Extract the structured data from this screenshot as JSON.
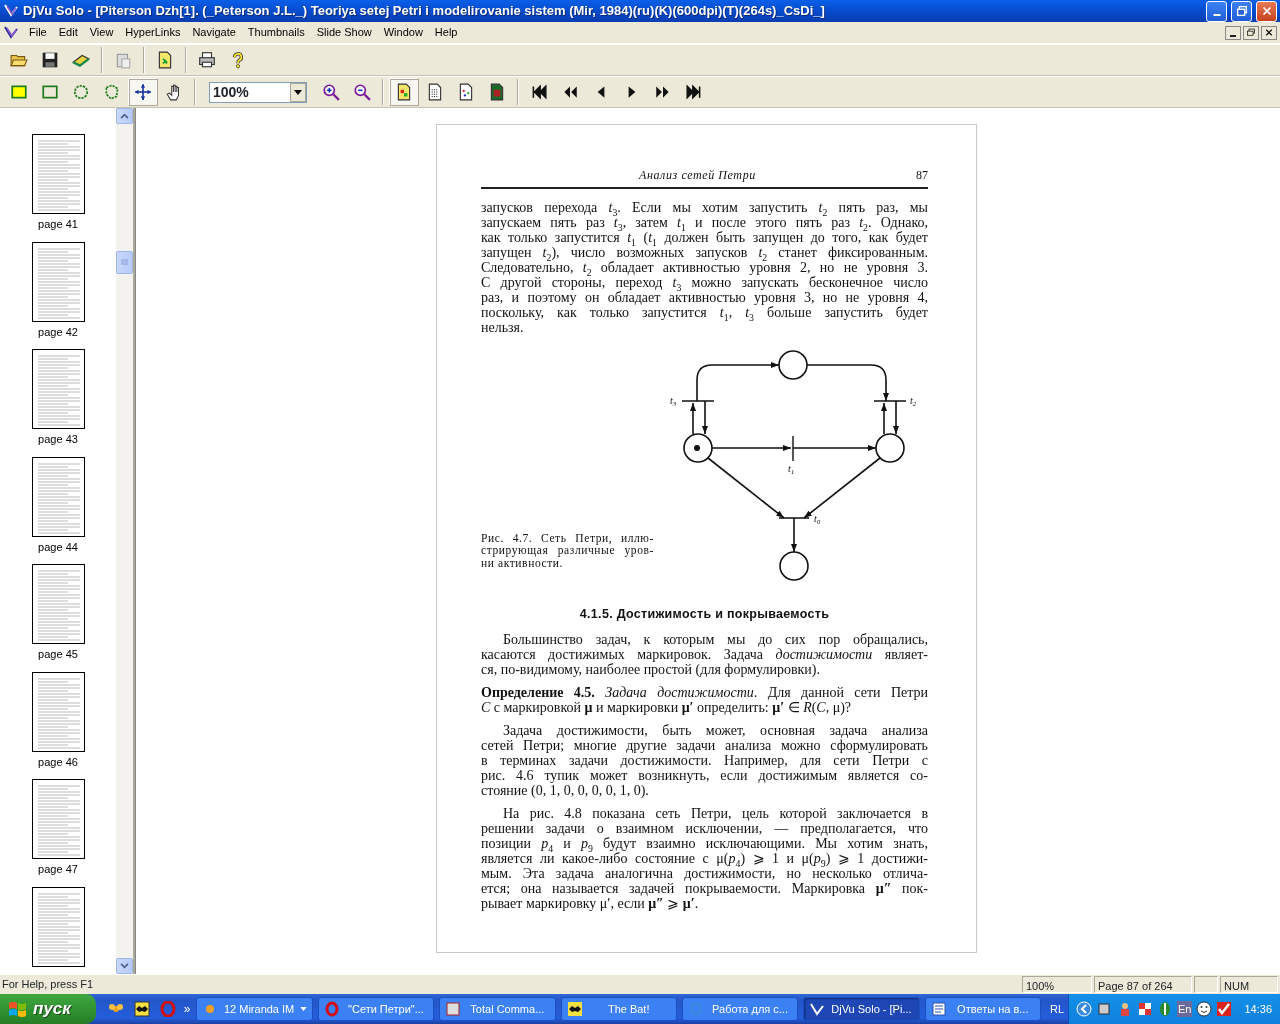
{
  "window": {
    "title": "DjVu Solo - [Piterson Dzh[1]. (_Peterson J.L._) Teoriya setej Petri i modelirovanie sistem (Mir, 1984)(ru)(K)(600dpi)(T)(264s)_CsDi_]"
  },
  "menu": [
    "File",
    "Edit",
    "View",
    "HyperLinks",
    "Navigate",
    "Thumbnails",
    "Slide Show",
    "Window",
    "Help"
  ],
  "tools": [
    {
      "selected": false
    },
    {
      "selected": false
    },
    {
      "selected": false
    },
    {
      "selected": false
    },
    {
      "selected": true
    },
    {
      "selected": false
    }
  ],
  "zoom": {
    "value": "100%"
  },
  "view_modes": [
    {
      "selected": true
    },
    {
      "selected": false
    },
    {
      "selected": false
    },
    {
      "selected": false
    }
  ],
  "thumbnails": [
    {
      "kind": "page",
      "label": "page 41"
    },
    {
      "kind": "page",
      "label": "page 42"
    },
    {
      "kind": "page",
      "label": "page 43"
    },
    {
      "kind": "page",
      "label": "page 44"
    },
    {
      "kind": "page",
      "label": "page 45"
    },
    {
      "kind": "page",
      "label": "page 46"
    },
    {
      "kind": "page",
      "label": "page 47"
    },
    {
      "kind": "page"
    }
  ],
  "page": {
    "running_title": "Анализ сетей Петри",
    "page_number": "87",
    "blocks": [
      {
        "kind": "paragraph",
        "indent": false,
        "lines": [
          "запусков перехода *t*$_{3}$. Если мы хотим запустить *t*$_{2}$ пять раз, мы",
          "запускаем пять раз *t*$_{3}$, затем *t*$_{1}$ и после этого пять раз *t*$_{2}$. Однако,",
          "как только запустится *t*$_{1}$ (*t*$_{1}$ должен быть запущен до того, как будет",
          "запущен *t*$_{2}$), число возможных запусков *t*$_{2}$ станет фиксированным.",
          "Следовательно, *t*$_{2}$ обладает активностью уровня 2, но не уровня 3.",
          "С другой стороны, переход *t*$_{3}$ можно запускать бесконечное число",
          "раз, и поэтому он обладает активностью уровня 3, но не уровня 4,",
          "поскольку, как только запустится *t*$_{1}$, *t*$_{3}$ больше запустить будет",
          "нельзя."
        ]
      },
      {
        "kind": "figure",
        "caption": [
          "Рис. 4.7. Сеть Петри, иллю-",
          "стрирующая различные уров-",
          "ни активности."
        ],
        "labels": [
          "*t*$_{3}$",
          "*t*$_{2}$",
          "*t*$_{1}$",
          "*t*$_{0}$"
        ]
      },
      {
        "kind": "heading",
        "text": "4.1.5. Достижимость и покрываемость"
      },
      {
        "kind": "paragraph",
        "indent": true,
        "lines": [
          "Большинство задач, к которым мы до сих пор обращались,",
          "касаются достижимых маркировок. Задача *достижимости* являет-",
          "ся, по-видимому, наиболее простой (для формулировки)."
        ]
      },
      {
        "kind": "paragraph",
        "indent": false,
        "lines": [
          "**Определение 4.5.** *Задача достижимости*. Для данной сети Петри",
          "*C* с маркировкой **μ** и маркировки **μ′** определить: **μ′** ∈ *R*(*C*, μ)?"
        ]
      },
      {
        "kind": "paragraph",
        "indent": true,
        "lines": [
          "Задача достижимости, быть может, основная задача анализа",
          "сетей Петри; многие другие задачи анализа можно сформулировать",
          "в терминах задачи достижимости. Например, для сети Петри с",
          "рис. 4.6 тупик может возникнуть, если достижимым является со-",
          "стояние (0, 1, 0, 0, 0, 0, 1, 0)."
        ]
      },
      {
        "kind": "paragraph",
        "indent": true,
        "lines": [
          "На рис. 4.8 показана сеть Петри, цель которой заключается в",
          "решении задачи о взаимном исключении, — предполагается, что",
          "позиции *p*$_{4}$ и *p*$_{9}$ будут взаимно исключающими. Мы хотим знать,",
          "является ли какое-либо состояние с μ(*p*$_{4}$) ⩾ 1 и μ(*p*$_{9}$) ⩾ 1 достижи-",
          "мым. Эта задача аналогична достижимости, но несколько отлича-",
          "ется; она называется задачей покрываемости. Маркировка **μ″** пок-",
          "рывает маркировку μ′, если **μ″** ⩾ **μ′**."
        ]
      }
    ]
  },
  "status_bar": {
    "help": "For Help, press F1",
    "zoom": "100%",
    "page": "Page 87 of 264",
    "num": "NUM"
  },
  "taskbar": {
    "start": "пуск",
    "more": "»",
    "tasks": [
      {
        "label": "12 Miranda IM",
        "selected": false,
        "grouped": true
      },
      {
        "label": "\"Сети Петри\"...",
        "selected": false,
        "grouped": false
      },
      {
        "label": "Total Comma...",
        "selected": false,
        "grouped": false
      },
      {
        "label": "The Bat!",
        "selected": false,
        "grouped": false
      },
      {
        "label": "Работа для с...",
        "selected": false,
        "grouped": false
      },
      {
        "label": "DjVu Solo - [Pi...",
        "selected": true,
        "grouped": false
      },
      {
        "label": "Ответы на в...",
        "selected": false,
        "grouped": false
      }
    ],
    "language": "RL",
    "input_language": "En",
    "clock": "14:36"
  }
}
